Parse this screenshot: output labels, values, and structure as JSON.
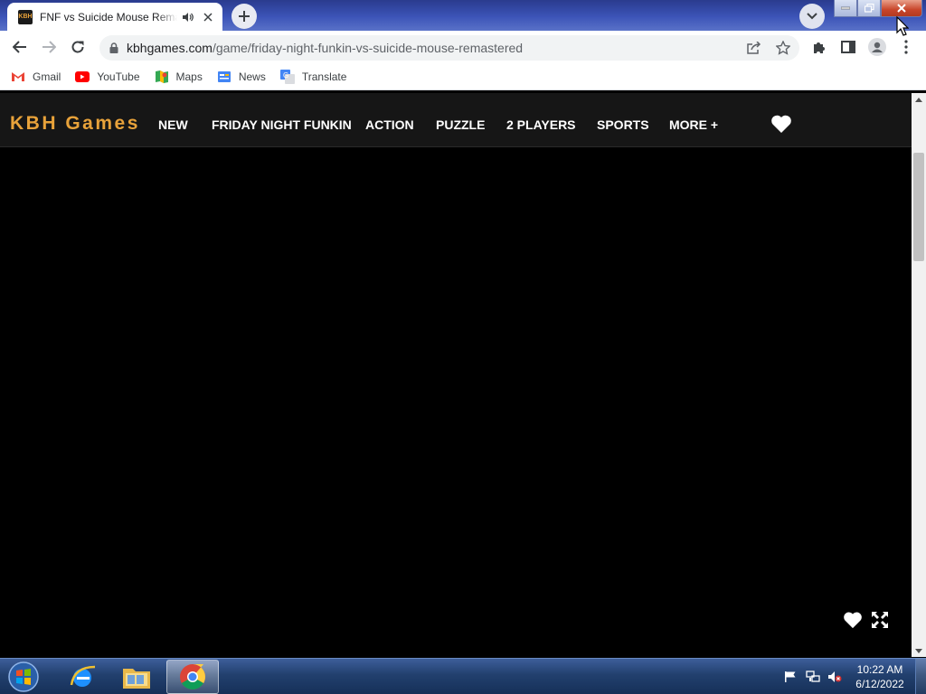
{
  "browser": {
    "tab": {
      "title": "FNF vs Suicide Mouse Remastered",
      "favicon_text": "KBH"
    },
    "omnibox": {
      "url_host": "kbhgames.com",
      "url_path": "/game/friday-night-funkin-vs-suicide-mouse-remastered"
    },
    "bookmarks": [
      {
        "label": "Gmail",
        "icon": "gmail-icon"
      },
      {
        "label": "YouTube",
        "icon": "youtube-icon"
      },
      {
        "label": "Maps",
        "icon": "maps-icon"
      },
      {
        "label": "News",
        "icon": "news-icon"
      },
      {
        "label": "Translate",
        "icon": "translate-icon"
      }
    ]
  },
  "site": {
    "logo": "KBH Games",
    "nav": [
      {
        "label": "NEW"
      },
      {
        "label": "FRIDAY NIGHT FUNKIN"
      },
      {
        "label": "ACTION"
      },
      {
        "label": "PUZZLE"
      },
      {
        "label": "2 PLAYERS"
      },
      {
        "label": "SPORTS"
      },
      {
        "label": "MORE +"
      }
    ]
  },
  "taskbar": {
    "apps": [
      "internet-explorer-icon",
      "file-explorer-icon",
      "chrome-icon"
    ],
    "clock_time": "10:22 AM",
    "clock_date": "6/12/2022"
  },
  "colors": {
    "accent": "#e8a23a",
    "nav_bg": "#161616",
    "taskbar": "#22406e"
  }
}
